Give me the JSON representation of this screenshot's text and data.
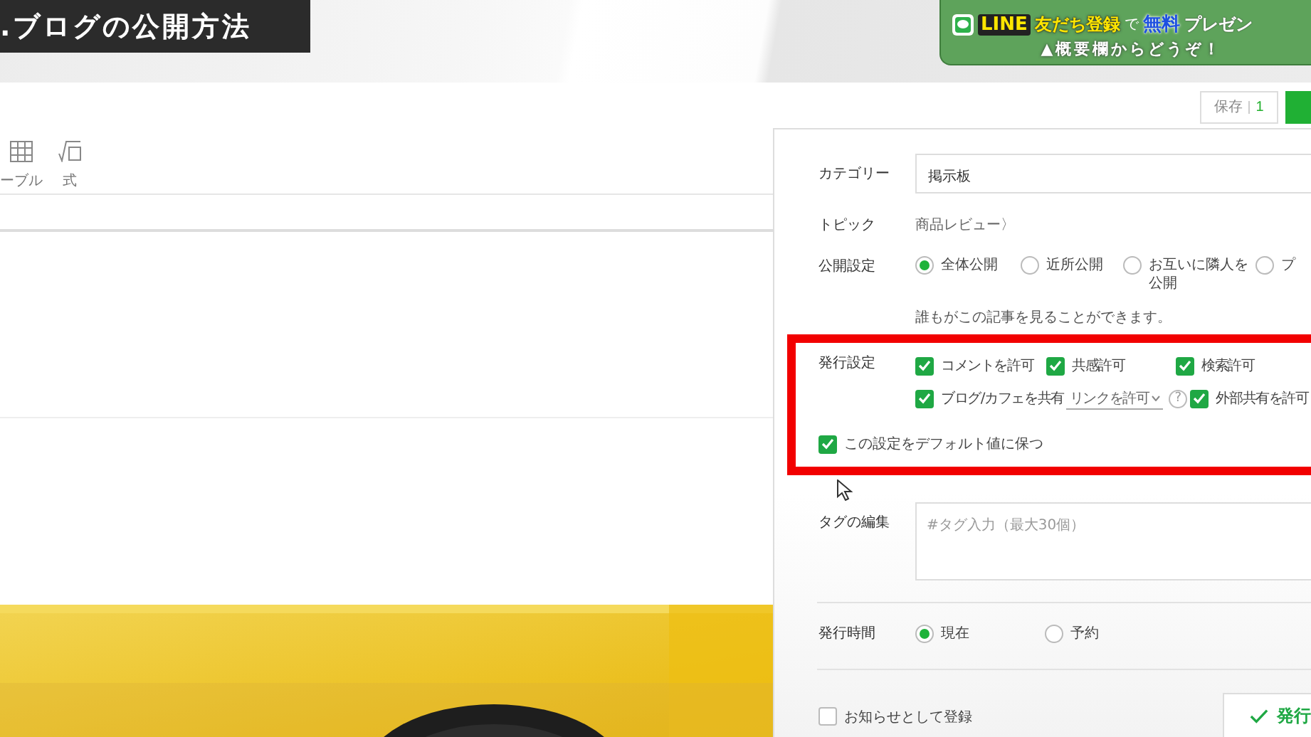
{
  "video_title": ".ブログの公開方法",
  "promo": {
    "badge": "LINE",
    "parts": [
      {
        "kind": "yellow",
        "text": "友だち登録"
      },
      {
        "kind": "plain-small",
        "text": "で"
      },
      {
        "kind": "blue",
        "text": "無料"
      },
      {
        "kind": "plain",
        "text": "プレゼン"
      }
    ],
    "note": "▲概要欄からどうぞ！"
  },
  "top_bar": {
    "save_label": "保存",
    "save_count": "1"
  },
  "editor_tools": [
    {
      "kind": "table",
      "label": "ーブル"
    },
    {
      "kind": "formula",
      "label": "式"
    }
  ],
  "settings": {
    "category": {
      "label": "カテゴリー",
      "value": "掲示板"
    },
    "topic": {
      "label": "トピック",
      "value": "商品レビュー〉"
    },
    "visibility": {
      "label": "公開設定",
      "options": [
        {
          "label": "全体公開",
          "selected": true
        },
        {
          "label": "近所公開",
          "selected": false
        },
        {
          "label": "お互いに隣人を公開",
          "selected": false
        },
        {
          "label": "プ",
          "selected": false
        }
      ],
      "hint": "誰もがこの記事を見ることができます。"
    },
    "publish_settings": {
      "label": "発行設定",
      "highlighted": true,
      "options": [
        {
          "label": "コメントを許可",
          "checked": true
        },
        {
          "label": "共感許可",
          "checked": true
        },
        {
          "label": "検索許可",
          "checked": true
        },
        {
          "label": "ブログ/カフェを共有",
          "checked": true,
          "select": "リンクを許可",
          "help": "?"
        },
        {
          "label": "外部共有を許可",
          "checked": true
        }
      ],
      "keep_default": {
        "label": "この設定をデフォルト値に保つ",
        "checked": true
      }
    },
    "tags": {
      "label": "タグの編集",
      "placeholder": "#タグ入力（最大30個）"
    },
    "publish_time": {
      "label": "発行時間",
      "options": [
        {
          "label": "現在",
          "selected": true
        },
        {
          "label": "予約",
          "selected": false
        }
      ]
    },
    "notice": {
      "label": "お知らせとして登録",
      "checked": false
    },
    "publish_button": "発行"
  }
}
